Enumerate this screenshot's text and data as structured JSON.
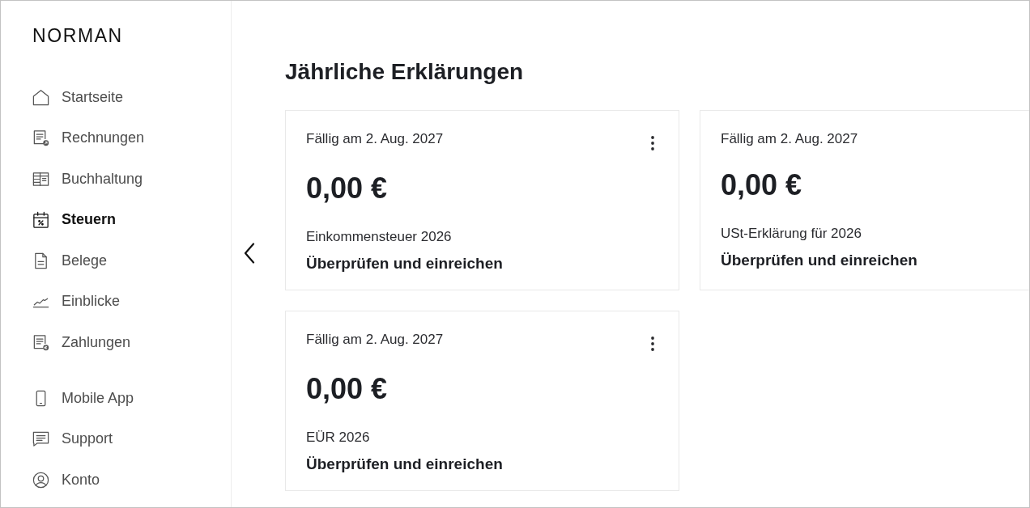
{
  "sidebar": {
    "logo": "NORMAN",
    "items": [
      {
        "label": "Startseite",
        "selected": false
      },
      {
        "label": "Rechnungen",
        "selected": false
      },
      {
        "label": "Buchhaltung",
        "selected": false
      },
      {
        "label": "Steuern",
        "selected": true
      },
      {
        "label": "Belege",
        "selected": false
      },
      {
        "label": "Einblicke",
        "selected": false
      },
      {
        "label": "Zahlungen",
        "selected": false
      }
    ],
    "bottom_items": [
      {
        "label": "Mobile App",
        "selected": false
      },
      {
        "label": "Support",
        "selected": false
      },
      {
        "label": "Konto",
        "selected": false
      }
    ]
  },
  "page": {
    "title": "Jährliche Erklärungen"
  },
  "cards": [
    {
      "due": "Fällig am 2. Aug. 2027",
      "amount": "0,00 €",
      "title": "Einkommensteuer 2026",
      "action": "Überprüfen und einreichen",
      "menu": true
    },
    {
      "due": "Fällig am 2. Aug. 2027",
      "amount": "0,00 €",
      "title": "USt-Erklärung für 2026",
      "action": "Überprüfen und einreichen",
      "menu": false
    },
    {
      "due": "Fällig am 2. Aug. 2027",
      "amount": "0,00 €",
      "title": "EÜR 2026",
      "action": "Überprüfen und einreichen",
      "menu": true
    }
  ]
}
